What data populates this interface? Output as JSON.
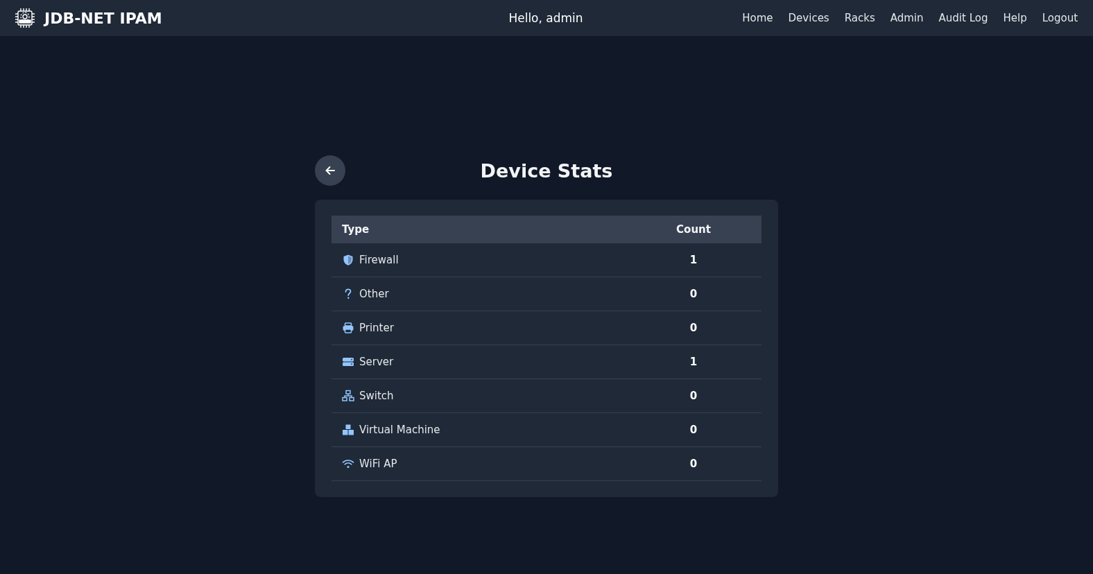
{
  "navbar": {
    "brand": "JDB-NET IPAM",
    "greeting": "Hello, admin",
    "links": [
      "Home",
      "Devices",
      "Racks",
      "Admin",
      "Audit Log",
      "Help",
      "Logout"
    ]
  },
  "page": {
    "title": "Device Stats"
  },
  "table": {
    "columns": [
      "Type",
      "Count"
    ],
    "rows": [
      {
        "kind": "firewall",
        "type": "Firewall",
        "count": "1"
      },
      {
        "kind": "other",
        "type": "Other",
        "count": "0"
      },
      {
        "kind": "printer",
        "type": "Printer",
        "count": "0"
      },
      {
        "kind": "server",
        "type": "Server",
        "count": "1"
      },
      {
        "kind": "switch",
        "type": "Switch",
        "count": "0"
      },
      {
        "kind": "vm",
        "type": "Virtual Machine",
        "count": "0"
      },
      {
        "kind": "wifi",
        "type": "WiFi AP",
        "count": "0"
      }
    ]
  }
}
